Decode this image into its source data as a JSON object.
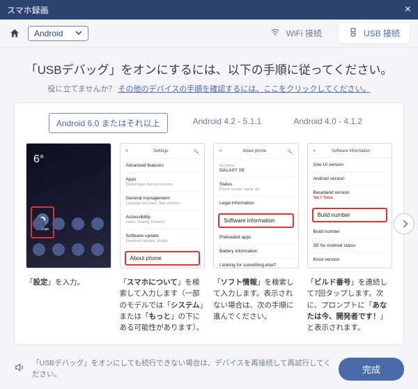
{
  "window": {
    "title": "スマホ録画"
  },
  "toolbar": {
    "device_dropdown": "Android",
    "wifi_label": "WiFi 接続",
    "usb_label": "USB 接続"
  },
  "main": {
    "headline": "「USBデバッグ」をオンにするには、以下の手順に従ってください。",
    "help_prefix": "役に立てませんか？",
    "help_link": "その他のデバイスの手順を確認するには、ここをクリックしてください。"
  },
  "tabs": [
    {
      "label": "Android 6.0 またはそれ以上",
      "active": true
    },
    {
      "label": "Android 4.2 - 5.1.1",
      "active": false
    },
    {
      "label": "Android 4.0 - 4.1.2",
      "active": false
    }
  ],
  "steps": [
    {
      "highlight_label": "Settings",
      "caption_html": "「<b>設定</b>」を入力。"
    },
    {
      "highlight_label": "About phone",
      "list_title": "Settings",
      "list_rows": [
        {
          "t": "Advanced features",
          "s": ""
        },
        {
          "t": "Apps",
          "s": "Default apps, App permissions"
        },
        {
          "t": "General management",
          "s": "Language and input, Date and time"
        },
        {
          "t": "Accessibility",
          "s": "Vision, Hearing, Dexterity"
        },
        {
          "t": "Software update",
          "s": "Download updates, Update"
        }
      ],
      "bottom_row": "About phone",
      "caption_html": "「<b>スマホについて</b>」を検索して入力します（一部のモデルでは「<b>システム</b>」または「<b>もっと</b>」の下にある可能性があります）。"
    },
    {
      "highlight_label": "Software information",
      "list_title": "About phone",
      "list_rows": [
        {
          "t": "Status",
          "s": "Phone number, signal, etc."
        },
        {
          "t": "Legal information",
          "s": ""
        }
      ],
      "after_rows": [
        {
          "t": "Preloaded apps",
          "s": ""
        },
        {
          "t": "Battery information",
          "s": ""
        },
        {
          "t": "Looking for something else?",
          "s": ""
        }
      ],
      "caption_html": "「<b>ソフト情報</b>」を検索して入力します。表示されない場合は、次の手順に進んでください。"
    },
    {
      "highlight_label": "Build number",
      "highlight_sub": "Tab 7 Times",
      "list_title": "Software information",
      "list_rows": [
        {
          "t": "One UI version",
          "s": ""
        },
        {
          "t": "Android version",
          "s": ""
        },
        {
          "t": "Baseband version",
          "s": ""
        }
      ],
      "after_rows": [
        {
          "t": "Build number",
          "s": ""
        },
        {
          "t": "SE for Android status",
          "s": ""
        },
        {
          "t": "Knox version",
          "s": ""
        }
      ],
      "caption_html": "「<b>ビルド番号</b>」を連続して7回タップします。次に、プロンプトに「<b>あなたは今、開発者です！</b>」と表示されます。"
    }
  ],
  "footer": {
    "note": "「USBデバッグ」をオンにしても続行できない場合は、デバイスを再接続して再試行してください。",
    "done": "完成"
  }
}
